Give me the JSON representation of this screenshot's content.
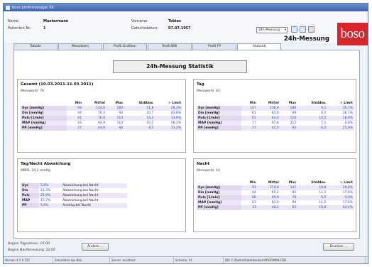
{
  "window": {
    "title": "boso profil-manager XS"
  },
  "header": {
    "name_label": "Name:",
    "name_value": "Mustermann",
    "patient_nr_label": "Patienten-Nr.:",
    "patient_nr_value": "1",
    "first_name_label": "Vorname:",
    "first_name_value": "Tobias",
    "birthdate_label": "Geburtsdatum:",
    "birthdate_value": "07.07.1957",
    "mode_value": "24h-Messung",
    "measure_title": "24h-Messung",
    "logo_text": "boso"
  },
  "tabs": [
    {
      "label": "Tabelle",
      "active": false
    },
    {
      "label": "Messdaten",
      "active": false
    },
    {
      "label": "Profil Grafiken",
      "active": false
    },
    {
      "label": "Profil BMI",
      "active": false
    },
    {
      "label": "Profil FP",
      "active": false
    },
    {
      "label": "Statistik",
      "active": true
    }
  ],
  "banner": "24h-Messung Statistik",
  "columns": [
    "",
    "Min",
    "Mittel",
    "Max",
    "StdAbw.",
    "> Limit"
  ],
  "panels": {
    "total": {
      "title": "Gesamt (10.03.2011-11.03.2011)",
      "sub": "Messwerte: 76",
      "rows": [
        [
          "Sys [mmHg]",
          "93",
          "124,0",
          "180",
          "11,8",
          "28,3%"
        ],
        [
          "Dia [mmHg]",
          "44",
          "76,3",
          "93",
          "10,7",
          "83,8%"
        ],
        [
          "Puls [1/min]",
          "61",
          "76,9",
          "110",
          "14,2",
          "13,9%"
        ],
        [
          "MAP [mmHg]",
          "63",
          "94,9",
          "110",
          "10,2",
          "26,2%"
        ],
        [
          "PP [mmHg]",
          "27",
          "44,9",
          "93",
          "8,5",
          "13,2%"
        ]
      ]
    },
    "day": {
      "title": "Tag",
      "sub": "Messwerte: 62",
      "rows": [
        [
          "Sys [mmHg]",
          "107",
          "136,9",
          "180",
          "9,1",
          "36,7%"
        ],
        [
          "Dia [mmHg]",
          "61",
          "83,0",
          "99",
          "6,5",
          "36,7%"
        ],
        [
          "Puls [1/min]",
          "61",
          "83,0",
          "110",
          "10,5",
          "18,9%"
        ],
        [
          "MAP [mmHg]",
          "77",
          "97,6",
          "112",
          "7,2",
          "0,0%"
        ],
        [
          "PP [mmHg]",
          "27",
          "44,0",
          "93",
          "6,5",
          "25,0%"
        ]
      ]
    },
    "daynight": {
      "title": "Tag/Nacht Abweichung",
      "sub": "MBPS: 34,1 mmHg",
      "rows": [
        [
          "Sys",
          "5,8%",
          "Abweichung bei Nacht"
        ],
        [
          "Dia",
          "21,3%",
          "Abweichung bei Nacht"
        ],
        [
          "Puls",
          "25,9%",
          "Abweichung bei Nacht"
        ],
        [
          "MAP",
          "15,7%",
          "Abweichung bei Nacht"
        ],
        [
          "PP",
          "5,6%",
          "Anstieg bei Nacht"
        ]
      ]
    },
    "night": {
      "title": "Nacht",
      "sub": "Messwerte: 14",
      "rows": [
        [
          "Sys [mmHg]",
          "93",
          "119,9",
          "147",
          "16,8",
          "26,9%"
        ],
        [
          "Dia [mmHg]",
          "44",
          "65,2",
          "85",
          "11,1",
          "17,6%"
        ],
        [
          "Puls [1/min]",
          "60",
          "60,9",
          "78",
          "6,5",
          "0,0%"
        ],
        [
          "MAP [mmHg]",
          "63",
          "83,9",
          "99",
          "11,2",
          "17,6%"
        ],
        [
          "PP [mmHg]",
          "33",
          "46,2",
          "63",
          "10,8",
          "64,4%"
        ]
      ]
    }
  },
  "bottom": {
    "day_start_label": "Beginn Tagesmess.: 07:00",
    "night_start_label": "Beginn Nachtmessung: 22:00",
    "change_button": "Ändern ...",
    "print_button": "Drucken ..."
  },
  "statusbar": [
    "Version 4.1.0.122",
    "Simulation zyu Box",
    "Server: localhost",
    "Schema: 41",
    "DB: C:\\Daten\\Datenbanken\\PROFIMAN.FDB"
  ]
}
